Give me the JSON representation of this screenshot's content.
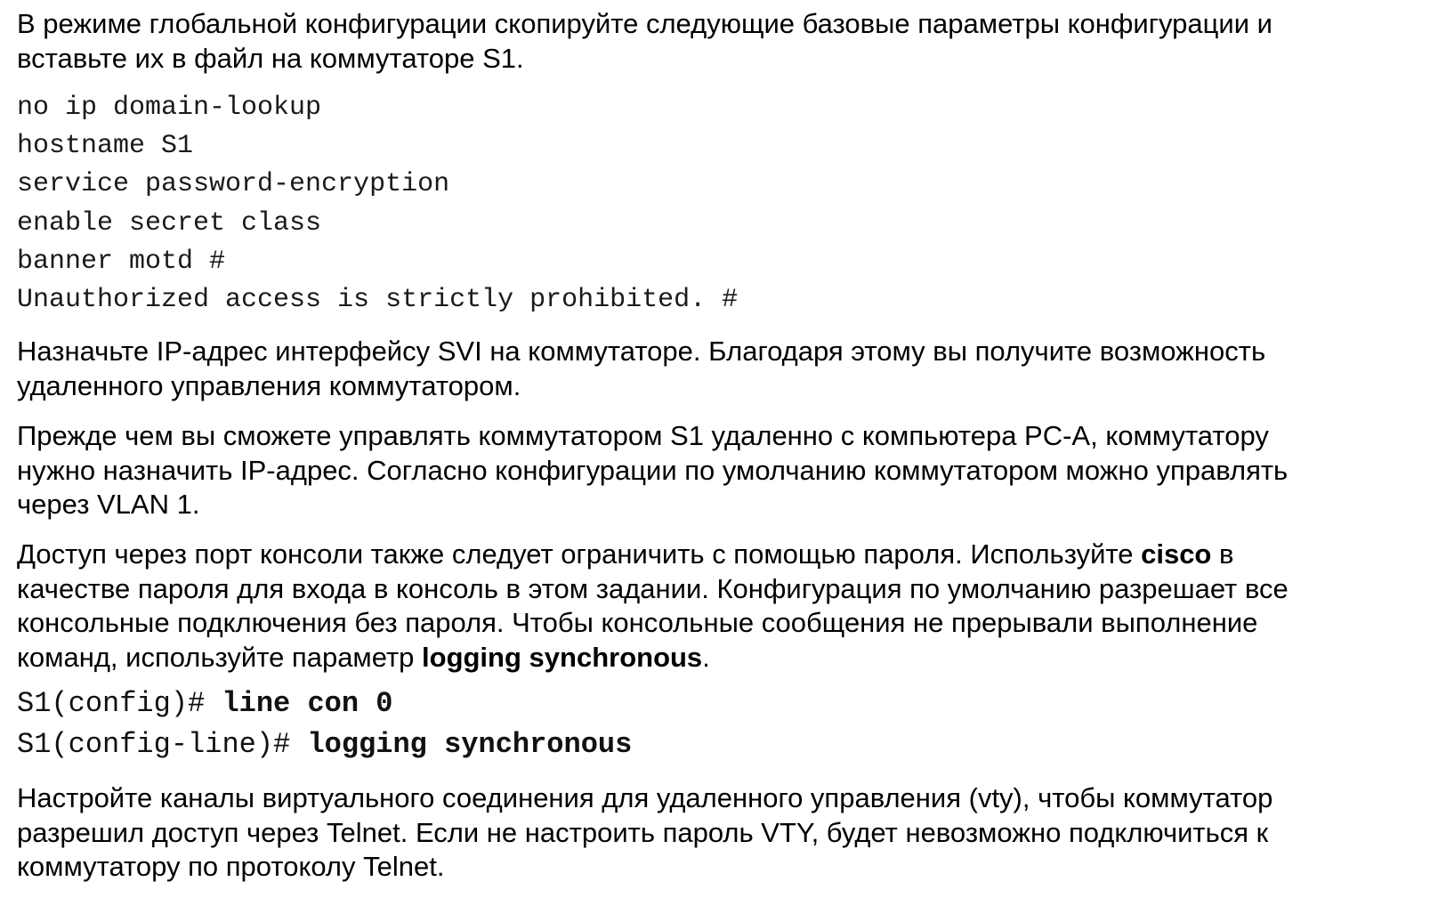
{
  "intro": {
    "line1": "В режиме глобальной конфигурации скопируйте следующие базовые параметры конфигурации и",
    "line2": "вставьте их в файл на коммутаторе S1."
  },
  "base_config": [
    "no ip domain-lookup",
    "hostname S1",
    "service password-encryption",
    "enable secret class",
    "banner motd #",
    "Unauthorized access is strictly prohibited. #"
  ],
  "svi": {
    "line1": "Назначьте IP-адрес интерфейсу SVI на коммутаторе. Благодаря этому вы получите возможность",
    "line2": "удаленного управления коммутатором."
  },
  "before": {
    "line1": "Прежде чем вы сможете управлять коммутатором S1 удаленно с компьютера PC-A, коммутатору",
    "line2": "нужно назначить IP-адрес. Согласно конфигурации по умолчанию коммутатором можно управлять",
    "line3": "через VLAN 1."
  },
  "console": {
    "line1_pre": "Доступ через порт консоли также следует ограничить  с помощью пароля. Используйте ",
    "line1_bold": "cisco",
    "line1_post": " в",
    "line2": "качестве пароля для входа в консоль в этом задании. Конфигурация по умолчанию разрешает все",
    "line3": "консольные подключения без пароля. Чтобы консольные сообщения не прерывали выполнение",
    "line4_pre": "команд, используйте параметр ",
    "line4_bold": "logging synchronous",
    "line4_post": "."
  },
  "cli": [
    {
      "prompt": "S1(config)# ",
      "command": "line con 0"
    },
    {
      "prompt": "S1(config-line)# ",
      "command": "logging synchronous"
    }
  ],
  "vty": {
    "line1": "Настройте каналы виртуального соединения для удаленного управления (vty), чтобы коммутатор",
    "line2": "разрешил доступ через Telnet. Если не настроить пароль VTY, будет невозможно подключиться к",
    "line3": "коммутатору по протоколу Telnet."
  }
}
